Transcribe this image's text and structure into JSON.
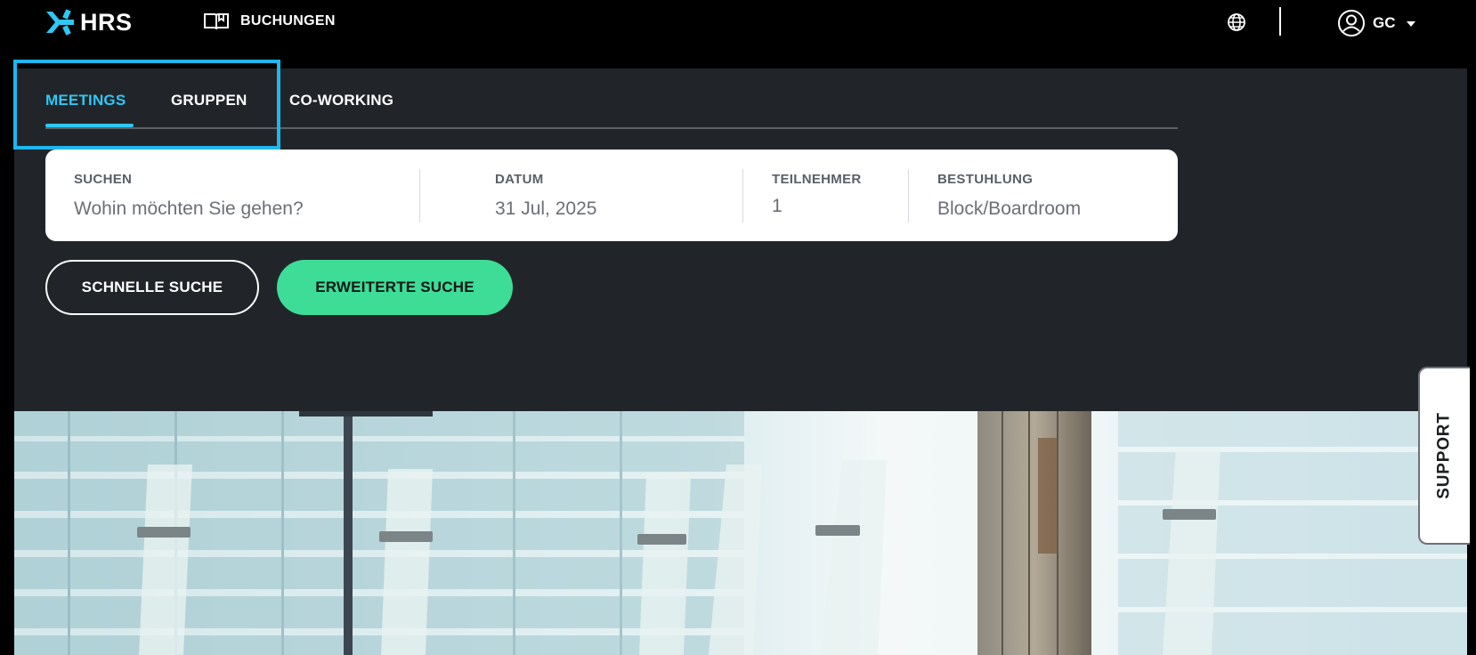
{
  "brand": {
    "name": "HRS",
    "accent": "#2fc7f5"
  },
  "topnav": {
    "bookings_label": "BUCHUNGEN",
    "language_icon": "globe-icon",
    "user_initials": "GC"
  },
  "tabs": [
    {
      "label": "MEETINGS",
      "active": true
    },
    {
      "label": "GRUPPEN",
      "active": false
    },
    {
      "label": "CO-WORKING",
      "active": false
    }
  ],
  "search": {
    "where_label": "SUCHEN",
    "where_placeholder": "Wohin möchten Sie gehen?",
    "date_label": "DATUM",
    "date_value": "31 Jul, 2025",
    "participants_label": "TEILNEHMER",
    "participants_value": "1",
    "seating_label": "BESTUHLUNG",
    "seating_value": "Block/Boardroom"
  },
  "actions": {
    "quick_search": "SCHNELLE SUCHE",
    "advanced_search": "ERWEITERTE SUCHE"
  },
  "support": {
    "label": "SUPPORT"
  },
  "colors": {
    "panel_bg": "#212529",
    "primary_green": "#3ddc97",
    "highlight_border": "#1fb6ee"
  }
}
